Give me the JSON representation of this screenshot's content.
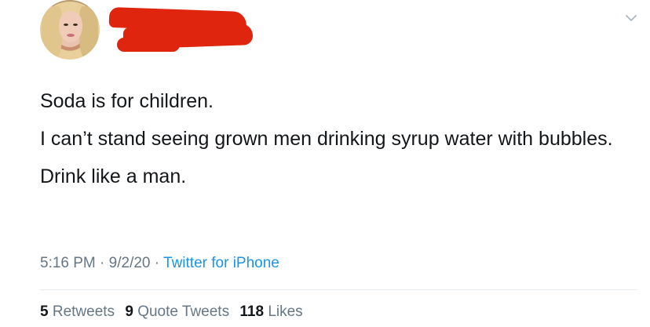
{
  "tweet": {
    "lines": [
      "Soda is for children.",
      "I can’t stand seeing grown men drinking syrup water with bubbles.",
      "Drink like a man."
    ],
    "time": "5:16 PM",
    "separator": "·",
    "date": "9/2/20",
    "source": "Twitter for iPhone"
  },
  "stats": {
    "retweets_count": "5",
    "retweets_label": "Retweets",
    "quotes_count": "9",
    "quotes_label": "Quote Tweets",
    "likes_count": "118",
    "likes_label": "Likes"
  },
  "colors": {
    "text": "#14171a",
    "secondary": "#657786",
    "link": "#1b95e0",
    "redaction": "#e0250e"
  }
}
